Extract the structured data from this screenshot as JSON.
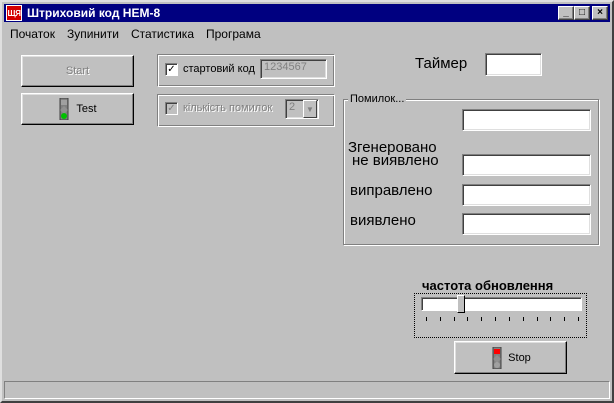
{
  "window": {
    "icon_text": "ЩЯ",
    "title": "Штриховий код НЕМ-8",
    "buttons": {
      "minimize": "_",
      "maximize": "□",
      "close": "×"
    }
  },
  "menu": [
    "Початок",
    "Зупинити",
    "Статистика",
    "Програма"
  ],
  "controls": {
    "start_label": "Start",
    "test_label": "Test",
    "start_code_label": "стартовий код",
    "start_code_value": "1234567",
    "error_count_label": "кількість помилок",
    "error_count_value": "2",
    "timer_label": "Таймер",
    "timer_value": ""
  },
  "errors_group": {
    "title": "Помилок...",
    "rows": [
      {
        "label": "Згенеровано",
        "value": ""
      },
      {
        "label": "не виявлено",
        "value": ""
      },
      {
        "label": "виправлено",
        "value": ""
      },
      {
        "label": "виявлено",
        "value": ""
      }
    ]
  },
  "refresh": {
    "label": "частота обновлення",
    "level_fraction": 0.25
  },
  "stop_label": "Stop",
  "colors": {
    "titlebar": "#000080",
    "window": "#c0c0c0",
    "traffic_red": "#ff0000",
    "traffic_green": "#00c000"
  }
}
